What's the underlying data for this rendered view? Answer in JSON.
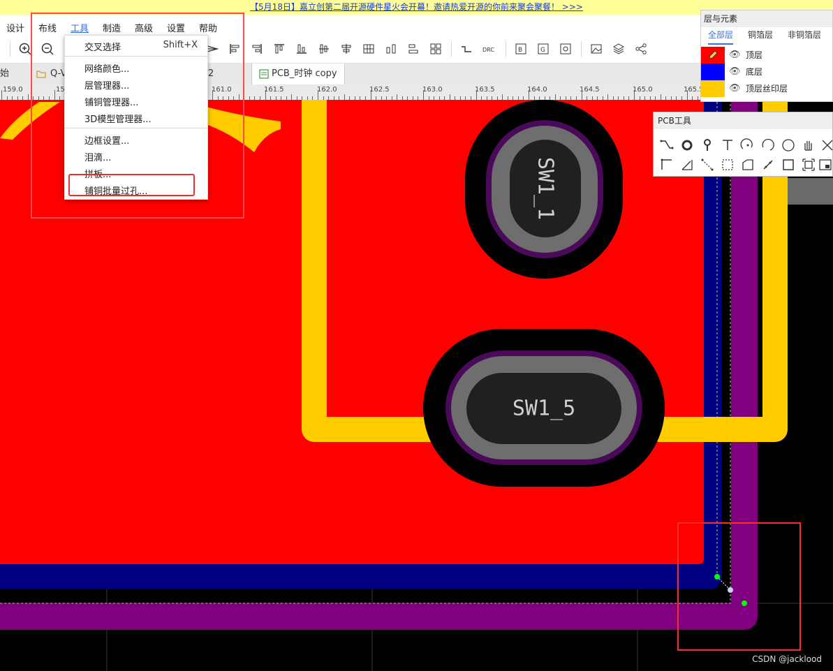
{
  "banner": {
    "text": "【5月18日】嘉立创第二届开源硬件星火会开幕！邀请热爱开源的你前来聚会聚餐！ >>>"
  },
  "menubar": {
    "items": [
      "设计",
      "布线",
      "工具",
      "制造",
      "高级",
      "设置",
      "帮助"
    ],
    "active": "工具"
  },
  "tabs": {
    "partial_1": "始",
    "partial_2": "Q-V",
    "partial_3": "2",
    "pcb": "PCB_时钟 copy"
  },
  "ruler": {
    "labels": [
      "159.0",
      "15",
      "161.0",
      "161.5",
      "162.0",
      "162.5",
      "163.0",
      "163.5",
      "164.0",
      "164.5",
      "165.0",
      "165.5"
    ]
  },
  "dropdown": {
    "items": [
      {
        "label": "交叉选择",
        "shortcut": "Shift+X"
      },
      {
        "label": "网络颜色..."
      },
      {
        "label": "层管理器..."
      },
      {
        "label": "铺铜管理器..."
      },
      {
        "label": "3D模型管理器..."
      },
      {
        "label": "边框设置..."
      },
      {
        "label": "泪滴..."
      },
      {
        "label": "拼板..."
      },
      {
        "label": "铺铜批量过孔..."
      }
    ]
  },
  "layers_panel": {
    "title": "层与元素",
    "tabs": [
      "全部层",
      "铜箔层",
      "非铜箔层"
    ],
    "active_tab": "全部层",
    "rows": [
      {
        "name": "顶层",
        "color": "#ff0000",
        "active": true
      },
      {
        "name": "底层",
        "color": "#0000ff",
        "active": false
      },
      {
        "name": "顶层丝印层",
        "color": "#ffcc00",
        "active": false
      }
    ]
  },
  "pcb_tools": {
    "title": "PCB工具"
  },
  "canvas": {
    "pad_top_label": "SW1_1",
    "pad_bottom_label": "SW1_5",
    "colors": {
      "copper": "#ff0000",
      "silk": "#ffcc00",
      "bottom": "#000080",
      "outline": "#800080"
    }
  },
  "watermark": "CSDN @jacklood"
}
